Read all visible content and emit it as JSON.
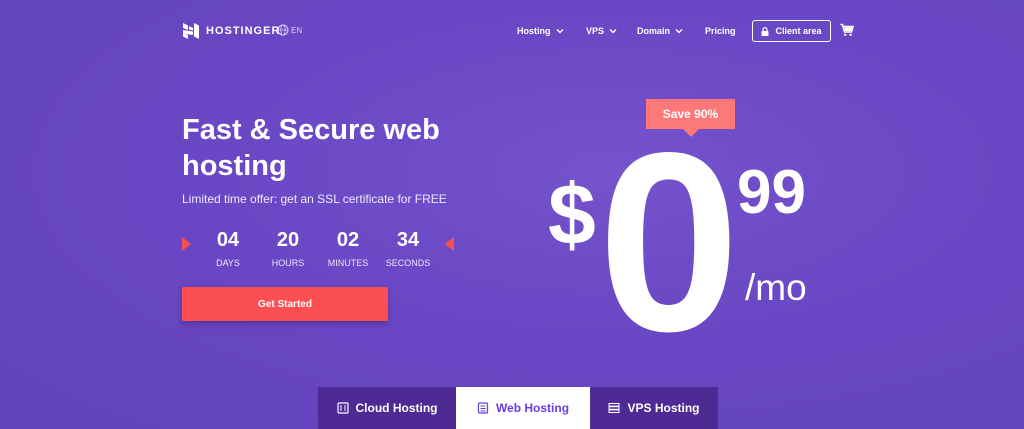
{
  "header": {
    "logo_text": "HOSTINGER",
    "language": "EN",
    "nav": [
      {
        "label": "Hosting",
        "dropdown": true
      },
      {
        "label": "VPS",
        "dropdown": true
      },
      {
        "label": "Domain",
        "dropdown": true
      },
      {
        "label": "Pricing",
        "dropdown": false
      }
    ],
    "client_area_label": "Client area",
    "icons": [
      "hostinger-logo-icon",
      "globe-icon",
      "chevron-down-icon",
      "lock-icon",
      "cart-icon"
    ]
  },
  "hero": {
    "title": "Fast & Secure web hosting",
    "offer": "Limited time offer: get an SSL certificate for FREE",
    "countdown": [
      {
        "value": "04",
        "label": "DAYS"
      },
      {
        "value": "20",
        "label": "HOURS"
      },
      {
        "value": "02",
        "label": "MINUTES"
      },
      {
        "value": "34",
        "label": "SECONDS"
      }
    ],
    "cta_label": "Get Started"
  },
  "price": {
    "badge": "Save 90%",
    "currency": "$",
    "whole": "0",
    "cents": "99",
    "period": "/mo"
  },
  "tabs": [
    {
      "label": "Cloud Hosting",
      "icon": "cloud-server-icon",
      "active": false
    },
    {
      "label": "Web Hosting",
      "icon": "web-server-icon",
      "active": true
    },
    {
      "label": "VPS Hosting",
      "icon": "vps-server-icon",
      "active": false
    }
  ],
  "colors": {
    "background": "#6c4ac7",
    "accent_red": "#fb4f52",
    "badge": "#fd7978",
    "tab_dark": "#4d2a94",
    "tab_active_text": "#673de6"
  }
}
